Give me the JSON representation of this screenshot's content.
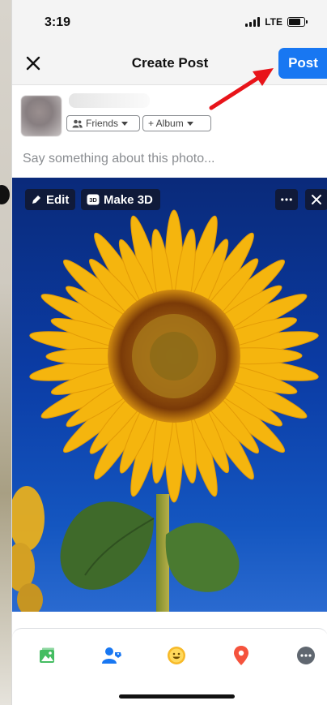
{
  "status_bar": {
    "time": "3:19",
    "network": "LTE"
  },
  "header": {
    "title": "Create Post",
    "post_label": "Post",
    "close_icon": "close-icon"
  },
  "composer": {
    "audience_label": "Friends",
    "album_label": "+ Album",
    "caption_placeholder": "Say something about this photo..."
  },
  "photo_toolbar": {
    "edit_label": "Edit",
    "make3d_label": "Make 3D",
    "more_icon": "more-icon",
    "remove_icon": "close-icon"
  },
  "bottom_bar": {
    "items": [
      "photo-icon",
      "tag-people-icon",
      "feeling-icon",
      "location-icon",
      "more-icon"
    ]
  },
  "colors": {
    "accent": "#1877f2",
    "photo_green": "#45bd62",
    "feeling_yellow": "#f7b928",
    "location_red": "#f5533d",
    "annotation_arrow": "#e8141a"
  }
}
